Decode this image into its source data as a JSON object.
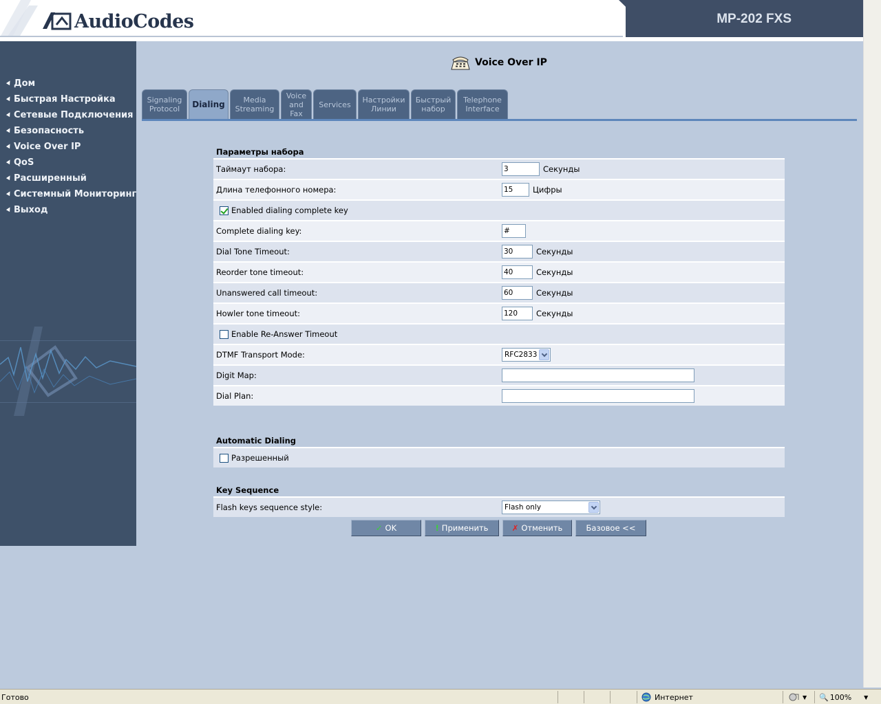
{
  "header": {
    "logo_text": "AudioCodes",
    "model": "MP-202 FXS"
  },
  "sidebar": {
    "items": [
      {
        "label": "Дом"
      },
      {
        "label": "Быстрая Настройка"
      },
      {
        "label": "Сетевые Подключения"
      },
      {
        "label": "Безопасность"
      },
      {
        "label": "Voice Over IP"
      },
      {
        "label": "QoS"
      },
      {
        "label": "Расширенный"
      },
      {
        "label": "Системный Мониторинг"
      },
      {
        "label": "Выход"
      }
    ]
  },
  "page_title": "Voice Over IP",
  "tabs": [
    {
      "line1": "Signaling",
      "line2": "Protocol",
      "line3": "",
      "active": false
    },
    {
      "line1": "Dialing",
      "line2": "",
      "line3": "",
      "active": true
    },
    {
      "line1": "Media",
      "line2": "Streaming",
      "line3": "",
      "active": false
    },
    {
      "line1": "Voice",
      "line2": "and",
      "line3": "Fax",
      "active": false
    },
    {
      "line1": "Services",
      "line2": "",
      "line3": "",
      "active": false
    },
    {
      "line1": "Настройки",
      "line2": "Линии",
      "line3": "",
      "active": false
    },
    {
      "line1": "Быстрый",
      "line2": "набор",
      "line3": "",
      "active": false
    },
    {
      "line1": "Telephone",
      "line2": "Interface",
      "line3": "",
      "active": false
    }
  ],
  "dialing": {
    "section_title": "Параметры набора",
    "timeout_label": "Таймаут набора:",
    "timeout_value": "3",
    "timeout_unit": "Секунды",
    "length_label": "Длина телефонного номера:",
    "length_value": "15",
    "length_unit": "Цифры",
    "complete_key_enabled_label": "Enabled dialing complete key",
    "complete_key_enabled": true,
    "complete_key_label": "Complete dialing key:",
    "complete_key_value": "#",
    "dial_tone_label": "Dial Tone Timeout:",
    "dial_tone_value": "30",
    "dial_tone_unit": "Секунды",
    "reorder_label": "Reorder tone timeout:",
    "reorder_value": "40",
    "reorder_unit": "Секунды",
    "unanswered_label": "Unanswered call timeout:",
    "unanswered_value": "60",
    "unanswered_unit": "Секунды",
    "howler_label": "Howler tone timeout:",
    "howler_value": "120",
    "howler_unit": "Секунды",
    "reanswer_label": "Enable Re-Answer Timeout",
    "reanswer_enabled": false,
    "dtmf_label": "DTMF Transport Mode:",
    "dtmf_value": "RFC2833",
    "digit_map_label": "Digit Map:",
    "digit_map_value": "",
    "dial_plan_label": "Dial Plan:",
    "dial_plan_value": ""
  },
  "auto_dialing": {
    "section_title": "Automatic Dialing",
    "enabled_label": "Разрешенный",
    "enabled": false
  },
  "key_sequence": {
    "section_title": "Key Sequence",
    "flash_label": "Flash keys sequence style:",
    "flash_value": "Flash only"
  },
  "buttons": {
    "ok": "OK",
    "apply": "Применить",
    "cancel": "Отменить",
    "basic": "Базовое <<"
  },
  "statusbar": {
    "status": "Готово",
    "zone": "Интернет",
    "zoom": "100%"
  },
  "colors": {
    "sidebar": "#3e5169",
    "background": "#bccadd",
    "header_dark": "#3f4e66",
    "tab": "#4d6483",
    "tab_active": "#8fa8c9"
  }
}
